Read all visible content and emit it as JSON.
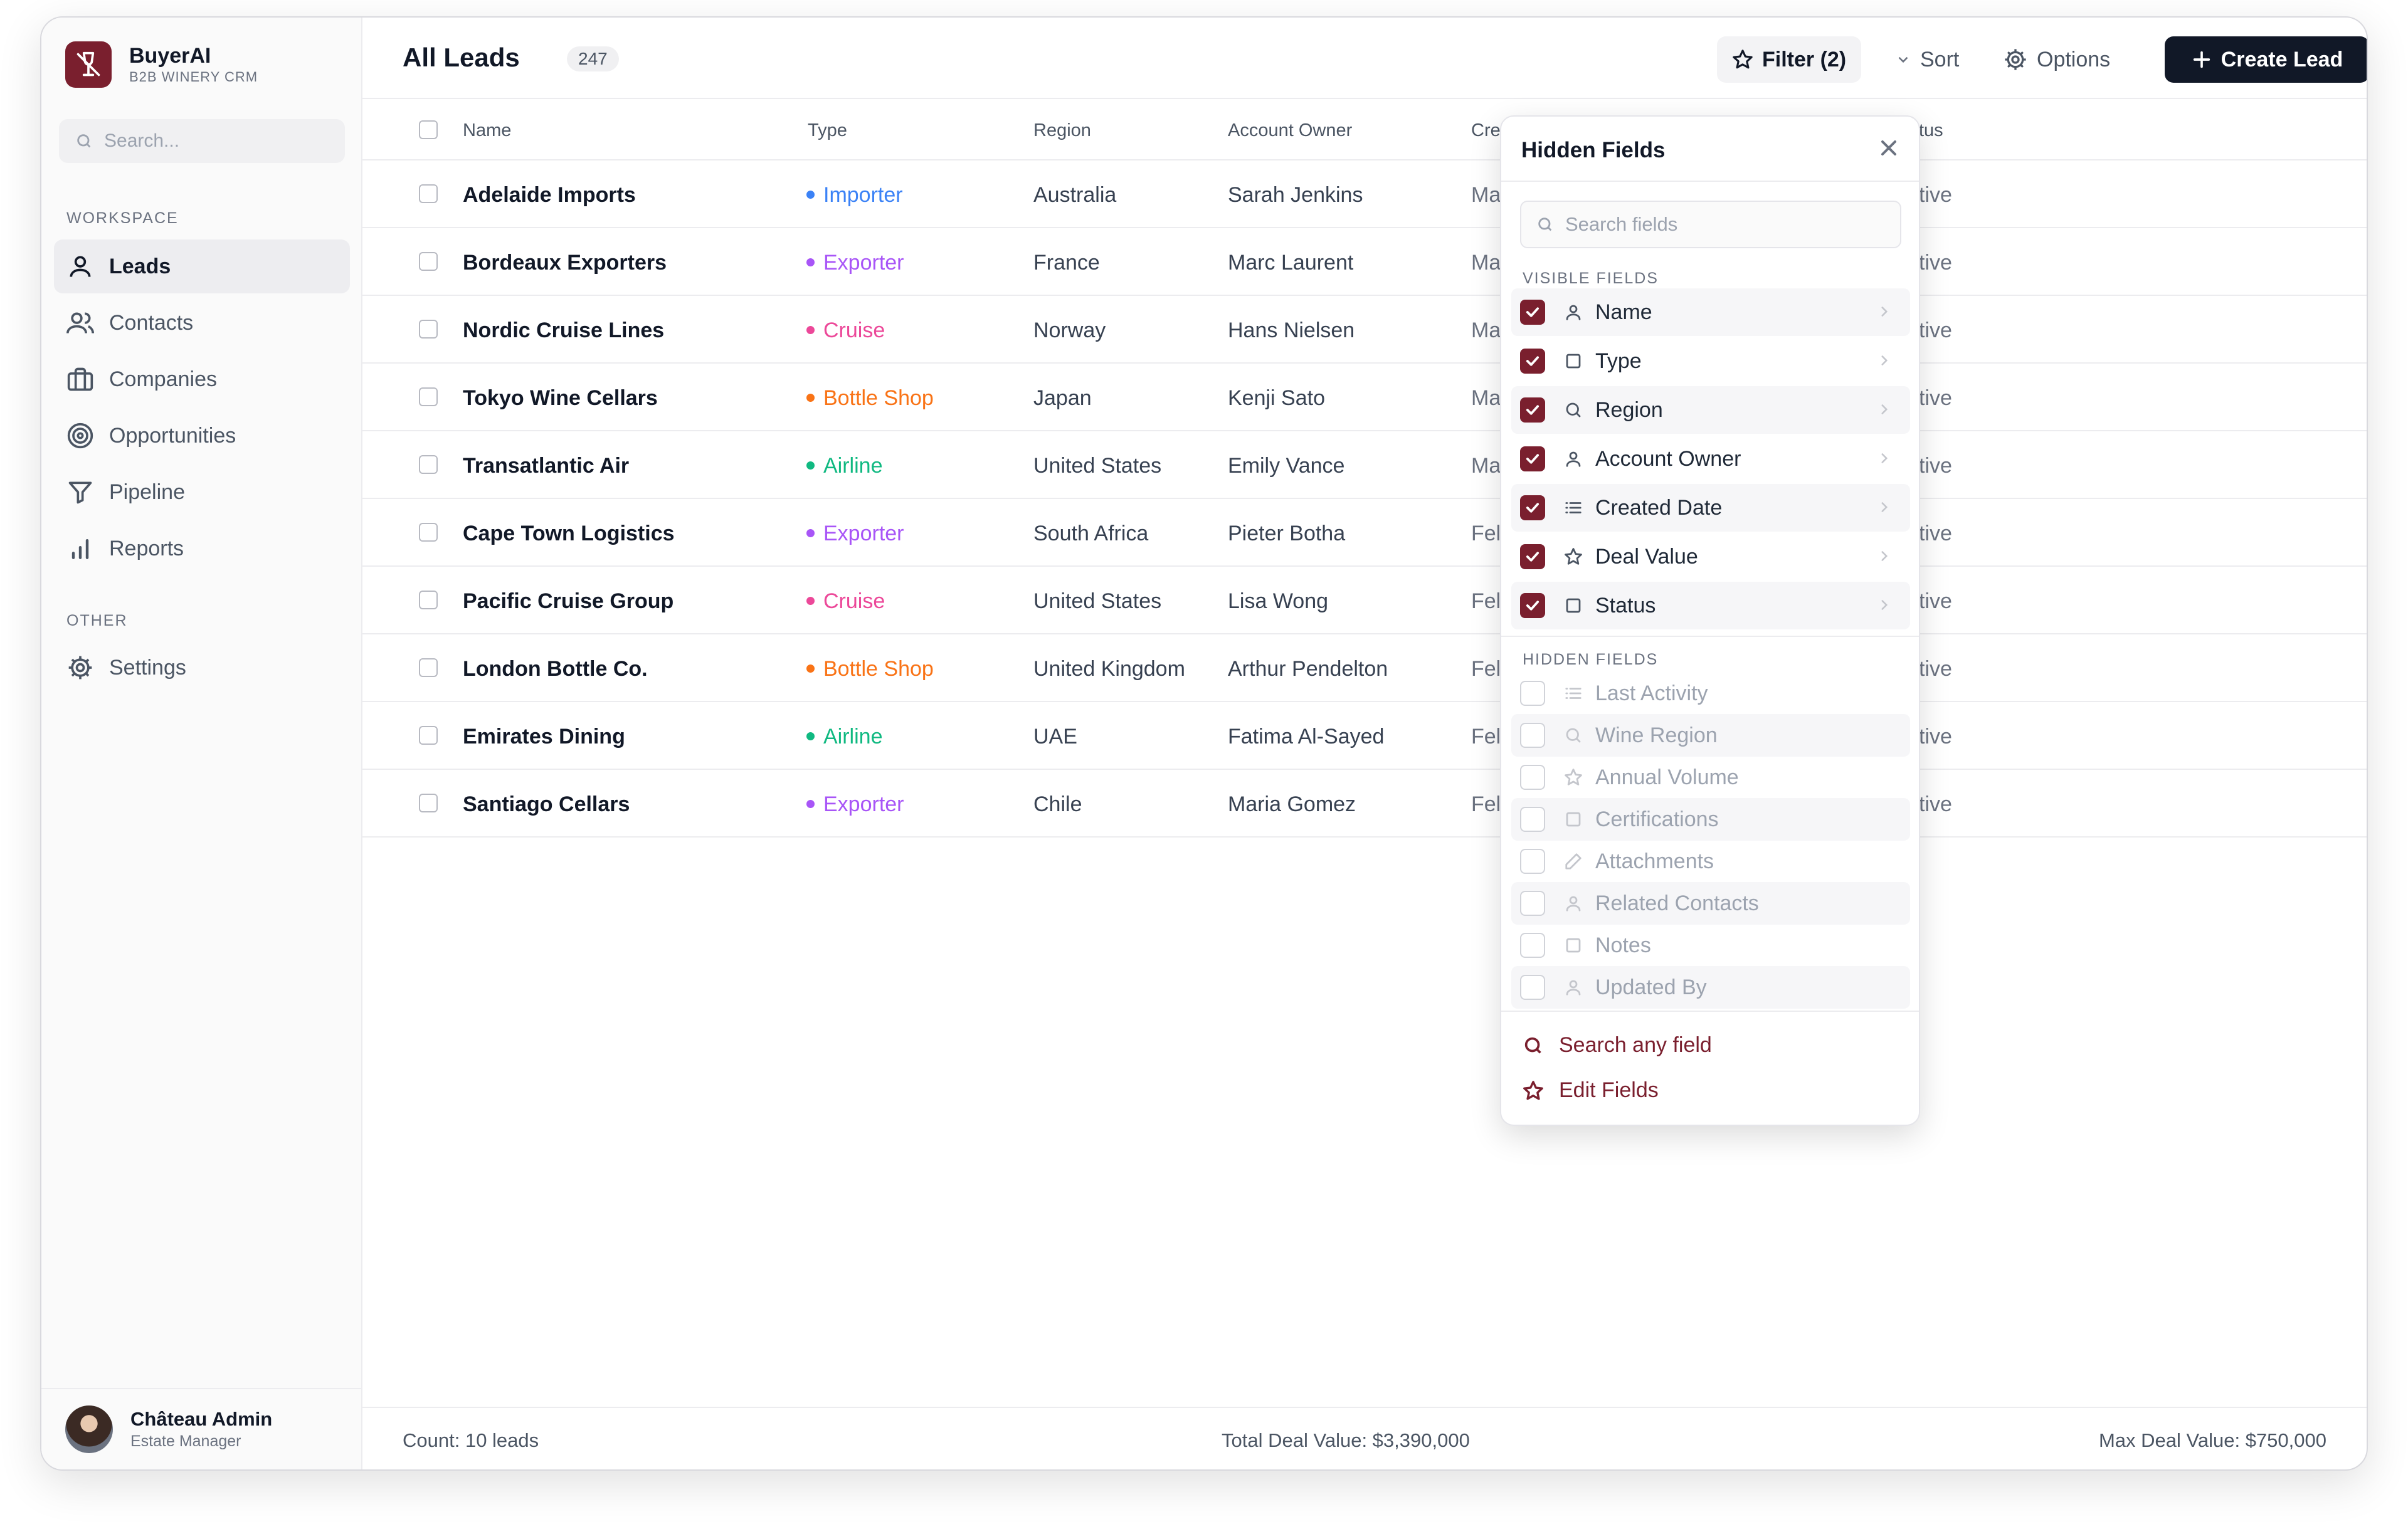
{
  "app": {
    "name": "BuyerAI",
    "subtitle": "B2B WINERY CRM"
  },
  "sidebar": {
    "search_placeholder": "Search...",
    "section_workspace": "WORKSPACE",
    "section_other": "OTHER",
    "items": [
      {
        "label": "Leads",
        "icon": "user-icon",
        "active": true
      },
      {
        "label": "Contacts",
        "icon": "users-icon"
      },
      {
        "label": "Companies",
        "icon": "briefcase-icon"
      },
      {
        "label": "Opportunities",
        "icon": "target-icon"
      },
      {
        "label": "Pipeline",
        "icon": "filter-funnel-icon"
      },
      {
        "label": "Reports",
        "icon": "bar-chart-icon"
      }
    ],
    "other_items": [
      {
        "label": "Settings",
        "icon": "gear-icon"
      }
    ],
    "user": {
      "name": "Château Admin",
      "role": "Estate Manager"
    }
  },
  "header": {
    "title": "All Leads",
    "count": "247",
    "filter_label": "Filter (2)",
    "sort_label": "Sort",
    "options_label": "Options",
    "create_label": "Create Lead"
  },
  "table": {
    "columns": [
      "Name",
      "Type",
      "Region",
      "Account Owner",
      "Cre",
      "tus"
    ],
    "rows": [
      {
        "name": "Adelaide Imports",
        "type": "Importer",
        "type_color": "#3b82f6",
        "region": "Australia",
        "owner": "Sarah Jenkins",
        "created": "Ma",
        "status": "tive"
      },
      {
        "name": "Bordeaux Exporters",
        "type": "Exporter",
        "type_color": "#a855f7",
        "region": "France",
        "owner": "Marc Laurent",
        "created": "Ma",
        "status": "tive"
      },
      {
        "name": "Nordic Cruise Lines",
        "type": "Cruise",
        "type_color": "#ec4899",
        "region": "Norway",
        "owner": "Hans Nielsen",
        "created": "Ma",
        "status": "tive"
      },
      {
        "name": "Tokyo Wine Cellars",
        "type": "Bottle Shop",
        "type_color": "#f97316",
        "region": "Japan",
        "owner": "Kenji Sato",
        "created": "Ma",
        "status": "tive"
      },
      {
        "name": "Transatlantic Air",
        "type": "Airline",
        "type_color": "#10b981",
        "region": "United States",
        "owner": "Emily Vance",
        "created": "Ma",
        "status": "tive"
      },
      {
        "name": "Cape Town Logistics",
        "type": "Exporter",
        "type_color": "#a855f7",
        "region": "South Africa",
        "owner": "Pieter Botha",
        "created": "Fel",
        "status": "tive"
      },
      {
        "name": "Pacific Cruise Group",
        "type": "Cruise",
        "type_color": "#ec4899",
        "region": "United States",
        "owner": "Lisa Wong",
        "created": "Fel",
        "status": "tive"
      },
      {
        "name": "London Bottle Co.",
        "type": "Bottle Shop",
        "type_color": "#f97316",
        "region": "United Kingdom",
        "owner": "Arthur Pendelton",
        "created": "Fel",
        "status": "tive"
      },
      {
        "name": "Emirates Dining",
        "type": "Airline",
        "type_color": "#10b981",
        "region": "UAE",
        "owner": "Fatima Al-Sayed",
        "created": "Fel",
        "status": "tive"
      },
      {
        "name": "Santiago Cellars",
        "type": "Exporter",
        "type_color": "#a855f7",
        "region": "Chile",
        "owner": "Maria Gomez",
        "created": "Fel",
        "status": "tive"
      }
    ]
  },
  "footer": {
    "count": "Count: 10 leads",
    "total": "Total Deal Value: $3,390,000",
    "max": "Max Deal Value: $750,000"
  },
  "panel": {
    "title": "Hidden Fields",
    "search_placeholder": "Search fields",
    "visible_label": "VISIBLE FIELDS",
    "hidden_label": "HIDDEN FIELDS",
    "visible_fields": [
      {
        "label": "Name",
        "icon": "user-icon"
      },
      {
        "label": "Type",
        "icon": "square-icon"
      },
      {
        "label": "Region",
        "icon": "search-icon"
      },
      {
        "label": "Account Owner",
        "icon": "user-icon"
      },
      {
        "label": "Created Date",
        "icon": "list-icon"
      },
      {
        "label": "Deal Value",
        "icon": "star-icon"
      },
      {
        "label": "Status",
        "icon": "square-icon"
      }
    ],
    "hidden_fields": [
      {
        "label": "Last Activity",
        "icon": "list-icon"
      },
      {
        "label": "Wine Region",
        "icon": "search-icon"
      },
      {
        "label": "Annual Volume",
        "icon": "star-icon"
      },
      {
        "label": "Certifications",
        "icon": "square-icon"
      },
      {
        "label": "Attachments",
        "icon": "pencil-icon"
      },
      {
        "label": "Related Contacts",
        "icon": "user-icon"
      },
      {
        "label": "Notes",
        "icon": "square-icon"
      },
      {
        "label": "Updated By",
        "icon": "user-icon"
      }
    ],
    "action_search": "Search any field",
    "action_edit": "Edit Fields"
  },
  "colors": {
    "accent": "#7a1f2e",
    "dark": "#111827"
  }
}
